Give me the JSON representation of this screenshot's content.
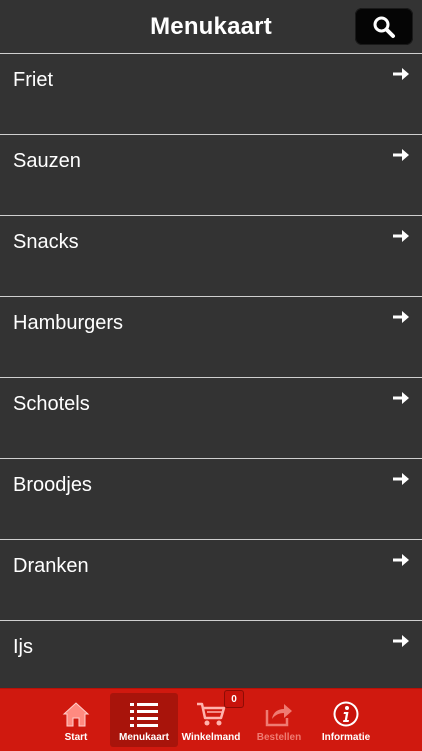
{
  "header": {
    "title": "Menukaart",
    "search_icon": "search-icon"
  },
  "menu": {
    "items": [
      {
        "label": "Friet"
      },
      {
        "label": "Sauzen"
      },
      {
        "label": "Snacks"
      },
      {
        "label": "Hamburgers"
      },
      {
        "label": "Schotels"
      },
      {
        "label": "Broodjes"
      },
      {
        "label": "Dranken"
      },
      {
        "label": "Ijs"
      }
    ],
    "arrow_icon": "arrow-right-icon"
  },
  "tabbar": {
    "tabs": [
      {
        "label": "Start",
        "icon": "home-icon"
      },
      {
        "label": "Menukaart",
        "icon": "list-icon",
        "active": true
      },
      {
        "label": "Winkelmand",
        "icon": "cart-icon"
      },
      {
        "label": "Bestellen",
        "icon": "share-icon",
        "disabled": true
      },
      {
        "label": "Informatie",
        "icon": "info-icon"
      }
    ],
    "cart_count": "0"
  },
  "colors": {
    "background": "#333333",
    "tabbar": "#d0190f",
    "tab_active": "#a8140b",
    "text": "#ffffff",
    "disabled_text": "#ef7b72"
  }
}
